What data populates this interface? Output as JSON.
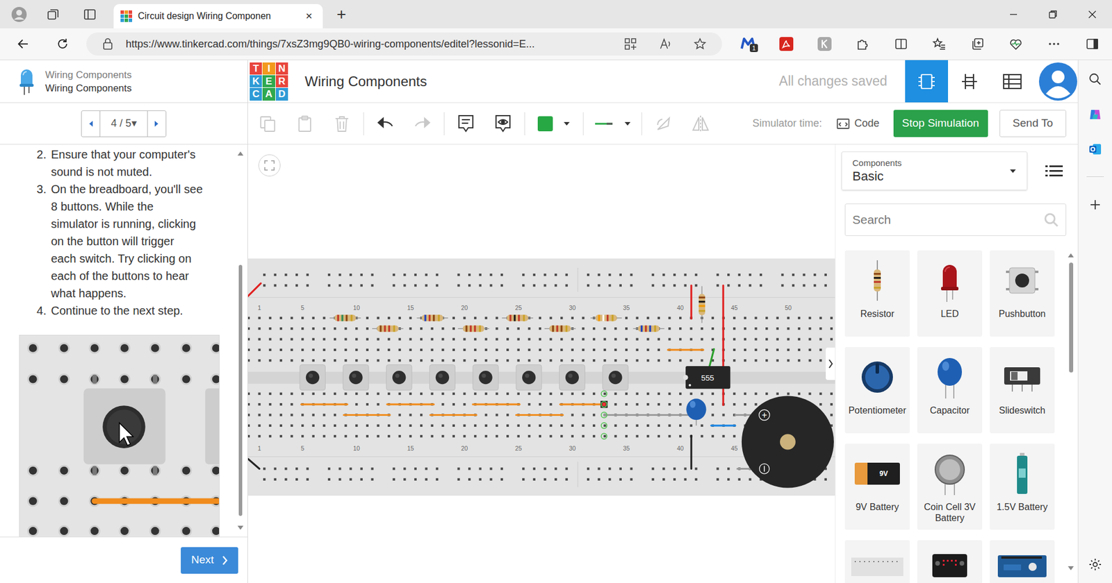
{
  "browser": {
    "tab": {
      "title": "Circuit design Wiring Componen",
      "close": "✕",
      "selected": true
    },
    "new_tab": "+",
    "url": "https://www.tinkercad.com/things/7xsZ3mg9QB0-wiring-components/editel?lessonid=E...",
    "extension_badge": "1"
  },
  "lesson": {
    "course": "Wiring Components",
    "title": "Wiring Components",
    "pager": "4 / 5▾",
    "steps": [
      {
        "number": "2.",
        "lines": [
          "Ensure that your computer's",
          "sound is not muted."
        ]
      },
      {
        "number": "3.",
        "lines": [
          "On the breadboard, you'll see",
          "8 buttons. While the",
          "simulator is running, clicking",
          "on the button will trigger",
          "each switch. Try clicking on",
          "each of the buttons to hear",
          "what happens."
        ]
      },
      {
        "number": "4.",
        "lines": [
          "Continue to the next step."
        ]
      }
    ],
    "next": "Next"
  },
  "app": {
    "logo": [
      {
        "letter": "T",
        "color": "#e8453c"
      },
      {
        "letter": "I",
        "color": "#f39a1e"
      },
      {
        "letter": "N",
        "color": "#e8453c"
      },
      {
        "letter": "K",
        "color": "#2e9bd6"
      },
      {
        "letter": "E",
        "color": "#2fa84f"
      },
      {
        "letter": "R",
        "color": "#e8453c"
      },
      {
        "letter": "C",
        "color": "#2e9bd6"
      },
      {
        "letter": "A",
        "color": "#2fa84f"
      },
      {
        "letter": "D",
        "color": "#2e9bd6"
      }
    ],
    "title": "Wiring Components",
    "save_status": "All changes saved",
    "views": [
      {
        "kind": "circuit",
        "selected": true
      },
      {
        "kind": "schematic",
        "selected": false
      },
      {
        "kind": "list",
        "selected": false
      }
    ]
  },
  "toolbar": {
    "wire_color": "#27a844",
    "simulator_time": "Simulator time:",
    "code": "Code",
    "stop_simulation": "Stop Simulation",
    "send_to": "Send To"
  },
  "breadboard": {
    "top_numbers": [
      "1",
      "5",
      "10",
      "15",
      "20",
      "25",
      "30",
      "35",
      "40",
      "45",
      "50"
    ],
    "bottom_numbers": [
      "1",
      "5",
      "10",
      "15",
      "20",
      "25",
      "30",
      "35",
      "40",
      "45"
    ],
    "chip_label": "555",
    "buzzer_plus": "+",
    "resistors": [
      {
        "bands": [
          "#c0392b",
          "#2e8b57",
          "#8b4513",
          "#c9a227"
        ]
      },
      {
        "bands": [
          "#8b4513",
          "#c0392b",
          "#c0392b",
          "#c9a227"
        ]
      },
      {
        "bands": [
          "#1f3fbf",
          "#c0392b",
          "#8b4513",
          "#c9a227"
        ]
      },
      {
        "bands": [
          "#8b4513",
          "#c0392b",
          "#c0392b",
          "#c9a227"
        ]
      },
      {
        "bands": [
          "#c0392b",
          "#1a1a1a",
          "#c0392b",
          "#c9a227"
        ]
      },
      {
        "bands": [
          "#8b4513",
          "#c0392b",
          "#8b4513",
          "#c9a227"
        ]
      },
      {
        "bands": [
          "#f29900",
          "#ffffff",
          "#c0392b",
          "#c9a227"
        ]
      },
      {
        "bands": [
          "#1f3fbf",
          "#c0392b",
          "#1f3fbf",
          "#c9a227"
        ]
      },
      {
        "bands": [
          "#8b4513",
          "#1a1a1a",
          "#f29900",
          "#c9a227"
        ]
      }
    ]
  },
  "components": {
    "header_label": "Components",
    "category": "Basic",
    "search_placeholder": "Search",
    "items": [
      {
        "label": "Resistor",
        "kind": "resistor"
      },
      {
        "label": "LED",
        "kind": "led"
      },
      {
        "label": "Pushbutton",
        "kind": "pushbutton"
      },
      {
        "label": "Potentiometer",
        "kind": "potentiometer"
      },
      {
        "label": "Capacitor",
        "kind": "capacitor"
      },
      {
        "label": "Slideswitch",
        "kind": "slideswitch"
      },
      {
        "label": "9V Battery",
        "kind": "battery9v",
        "badge": "9V"
      },
      {
        "label": "Coin Cell 3V Battery",
        "kind": "coincell"
      },
      {
        "label": "1.5V Battery",
        "kind": "battery15"
      }
    ],
    "more_items": [
      {
        "kind": "breadboard"
      },
      {
        "kind": "microbit"
      },
      {
        "kind": "arduino"
      }
    ]
  }
}
